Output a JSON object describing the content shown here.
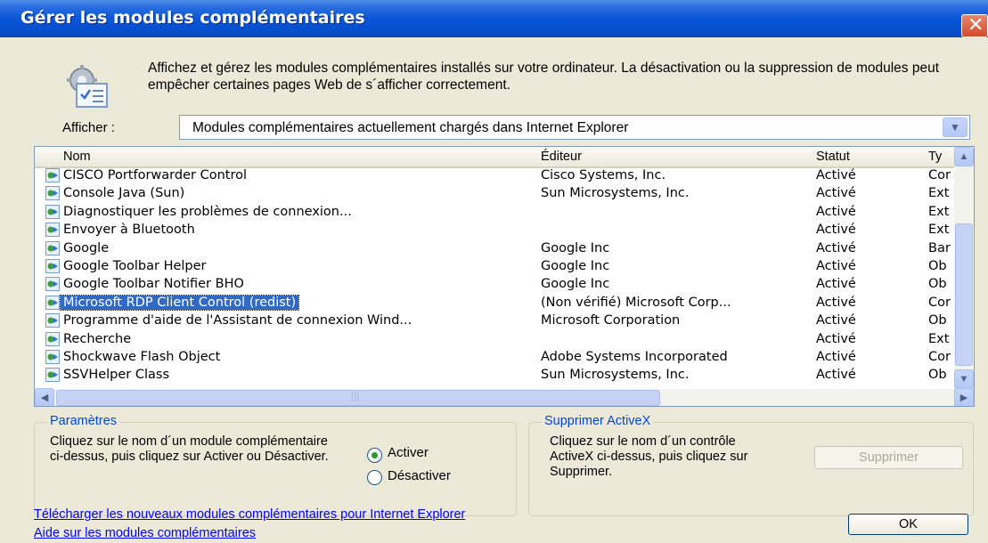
{
  "window": {
    "title": "Gérer les modules complémentaires",
    "close_glyph": "✕"
  },
  "intro_text": "Affichez et gérez les modules complémentaires installés sur votre ordinateur. La désactivation ou la suppression de modules peut empêcher certaines pages Web de s´afficher correctement.",
  "show": {
    "label": "Afficher :",
    "value": "Modules complémentaires actuellement chargés dans Internet Explorer"
  },
  "columns": {
    "name": "Nom",
    "publisher": "Éditeur",
    "status": "Statut",
    "type": "Ty"
  },
  "addons": [
    {
      "name": "CISCO Portforwarder Control",
      "publisher": "Cisco Systems, Inc.",
      "status": "Activé",
      "type": "Cor"
    },
    {
      "name": "Console Java (Sun)",
      "publisher": "Sun Microsystems, Inc.",
      "status": "Activé",
      "type": "Ext"
    },
    {
      "name": "Diagnostiquer les problèmes de connexion...",
      "publisher": "",
      "status": "Activé",
      "type": "Ext"
    },
    {
      "name": "Envoyer à Bluetooth",
      "publisher": "",
      "status": "Activé",
      "type": "Ext"
    },
    {
      "name": "Google",
      "publisher": "Google Inc",
      "status": "Activé",
      "type": "Bar"
    },
    {
      "name": "Google Toolbar Helper",
      "publisher": "Google Inc",
      "status": "Activé",
      "type": "Ob"
    },
    {
      "name": "Google Toolbar Notifier BHO",
      "publisher": "Google Inc",
      "status": "Activé",
      "type": "Ob"
    },
    {
      "name": "Microsoft RDP Client Control (redist)",
      "publisher": "(Non vérifié) Microsoft Corp...",
      "status": "Activé",
      "type": "Cor"
    },
    {
      "name": "Programme d'aide de l'Assistant de connexion Wind...",
      "publisher": "Microsoft Corporation",
      "status": "Activé",
      "type": "Ob"
    },
    {
      "name": "Recherche",
      "publisher": "",
      "status": "Activé",
      "type": "Ext"
    },
    {
      "name": "Shockwave Flash Object",
      "publisher": "Adobe Systems Incorporated",
      "status": "Activé",
      "type": "Cor"
    },
    {
      "name": "SSVHelper Class",
      "publisher": "Sun Microsystems, Inc.",
      "status": "Activé",
      "type": "Ob"
    }
  ],
  "selected_addon": "Microsoft RDP Client Control (redist)",
  "settings": {
    "legend": "Paramètres",
    "text": "Cliquez sur le nom d´un module complémentaire ci-dessus, puis cliquez sur Activer ou Désactiver.",
    "enable_label": "Activer",
    "disable_label": "Désactiver",
    "selected_option": "Activer"
  },
  "activex": {
    "legend": "Supprimer ActiveX",
    "text": "Cliquez sur le nom d´un contrôle ActiveX ci-dessus, puis cliquez sur Supprimer.",
    "delete_label": "Supprimer"
  },
  "links": {
    "download": "Télécharger les nouveaux modules complémentaires pour Internet Explorer",
    "help": "Aide sur les modules complémentaires"
  },
  "ok_label": "OK",
  "icons": {
    "scroll_up": "▲",
    "scroll_down": "▼",
    "scroll_left": "◀",
    "scroll_right": "▶",
    "grip": "|||",
    "dropdown": "▼"
  },
  "colors": {
    "titlebar": "#0a56d8",
    "selection": "#316ac5",
    "link": "#0000ff",
    "group_legend": "#0046d5",
    "dialog_bg": "#ece9d8"
  }
}
